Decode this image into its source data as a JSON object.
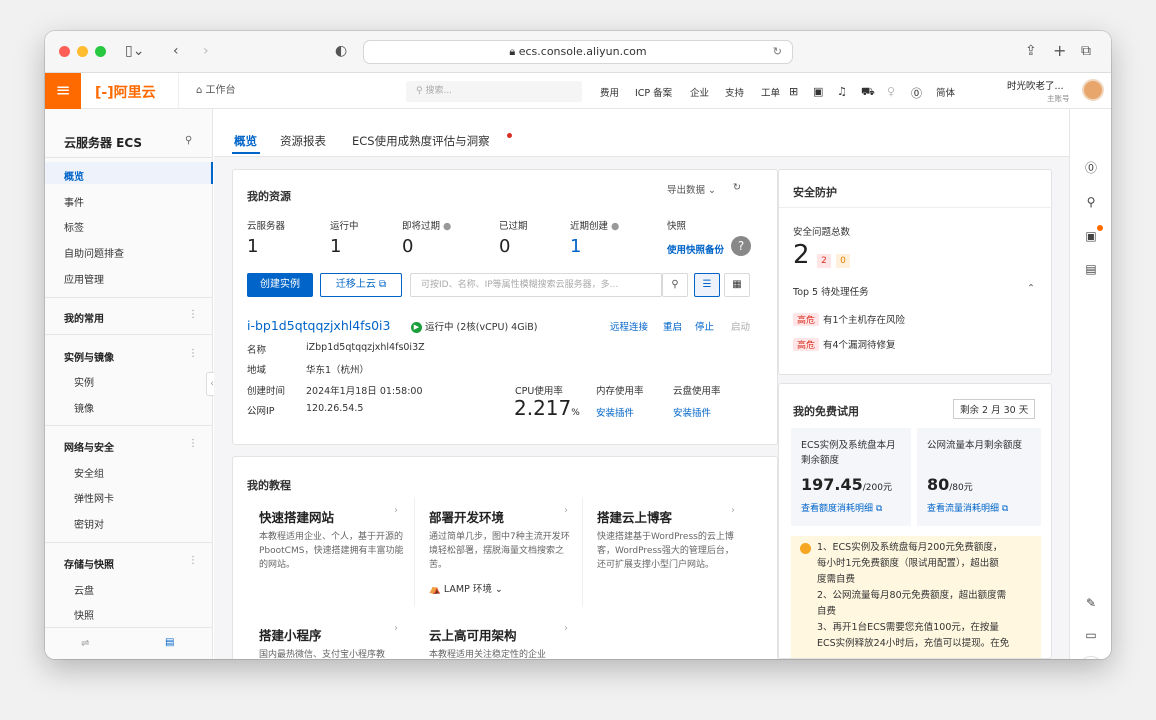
{
  "browser": {
    "url": "ecs.console.aliyun.com"
  },
  "topbar": {
    "logo": "阿里云",
    "workspace": "工作台",
    "search_placeholder": "搜索...",
    "nav": [
      "费用",
      "ICP 备案",
      "企业",
      "支持",
      "工单"
    ],
    "lang": "简体",
    "user": "时光吹老了...",
    "user_sub": "主账号"
  },
  "sidebar": {
    "title": "云服务器 ECS",
    "items": [
      "概览",
      "事件",
      "标签",
      "自助问题排查",
      "应用管理"
    ],
    "groups": [
      {
        "label": "我的常用",
        "items": []
      },
      {
        "label": "实例与镜像",
        "items": [
          "实例",
          "镜像"
        ]
      },
      {
        "label": "网络与安全",
        "items": [
          "安全组",
          "弹性网卡",
          "密钥对"
        ]
      },
      {
        "label": "存储与快照",
        "items": [
          "云盘",
          "快照"
        ]
      }
    ]
  },
  "tabs": [
    "概览",
    "资源报表",
    "ECS使用成熟度评估与洞察"
  ],
  "resources": {
    "title": "我的资源",
    "export": "导出数据",
    "labels": [
      "云服务器",
      "运行中",
      "即将过期",
      "已过期",
      "近期创建",
      "快照"
    ],
    "values": [
      "1",
      "1",
      "0",
      "0",
      "1"
    ],
    "snapshot_link": "使用快照备份",
    "create_btn": "创建实例",
    "migrate_btn": "迁移上云",
    "search_placeholder": "可按ID、名称、IP等属性模糊搜索云服务器，多..."
  },
  "instance": {
    "id": "i-bp1d5qtqqzjxhl4fs0i3",
    "status": "运行中 (2核(vCPU) 4GiB)",
    "actions": [
      "远程连接",
      "重启",
      "停止",
      "启动"
    ],
    "name_label": "名称",
    "name": "iZbp1d5qtqqzjxhl4fs0i3Z",
    "region_label": "地域",
    "region": "华东1（杭州）",
    "created_label": "创建时间",
    "created": "2024年1月18日 01:58:00",
    "ip_label": "公网IP",
    "ip": "120.26.54.5",
    "cpu_label": "CPU使用率",
    "cpu_value": "2.217",
    "cpu_unit": "%",
    "mem_label": "内存使用率",
    "mem_link": "安装插件",
    "disk_label": "云盘使用率",
    "disk_link": "安装插件"
  },
  "tutorials": {
    "title": "我的教程",
    "items": [
      {
        "title": "快速搭建网站",
        "desc": "本教程适用企业、个人，基于开源的PbootCMS，快速搭建拥有丰富功能的网站。"
      },
      {
        "title": "部署开发环境",
        "desc": "通过简单几步，图中7种主流开发环境轻松部署，摆脱海量文档搜索之苦。",
        "extra": "LAMP 环境"
      },
      {
        "title": "搭建云上博客",
        "desc": "快速搭建基于WordPress的云上博客，WordPress强大的管理后台，还可扩展支撑小型门户网站。"
      },
      {
        "title": "搭建小程序",
        "desc": "国内最热微信、支付宝小程序教"
      },
      {
        "title": "云上高可用架构",
        "desc": "本教程适用关注稳定性的企业"
      }
    ]
  },
  "security": {
    "title": "安全防护",
    "total_label": "安全问题总数",
    "total": "2",
    "badge_red": "2",
    "badge_orange": "0",
    "top5": "Top 5 待处理任务",
    "tasks": [
      {
        "level": "高危",
        "text": "有1个主机存在风险"
      },
      {
        "level": "高危",
        "text": "有4个漏洞待修复"
      }
    ]
  },
  "trial": {
    "title": "我的免费试用",
    "remaining": "剩余 2 月 30 天",
    "ecs_label": "ECS实例及系统盘本月剩余额度",
    "ecs_value": "197.45",
    "ecs_unit": "/200元",
    "ecs_link": "查看额度消耗明细",
    "net_label": "公网流量本月剩余额度",
    "net_value": "80",
    "net_unit": "/80元",
    "net_link": "查看流量消耗明细",
    "notice": [
      "1、ECS实例及系统盘每月200元免费额度，",
      "每小时1元免费额度（限试用配置），超出额",
      "度需自费",
      "2、公网流量每月80元免费额度，超出额度需",
      "自费",
      "3、再开1台ECS需要您充值100元，在按量",
      "ECS实例释放24小时后，充值可以提现。在免"
    ]
  },
  "colors": {
    "brand": "#ff6a00",
    "link": "#0064c8",
    "danger": "#d93026",
    "running": "#1a9e3a"
  }
}
